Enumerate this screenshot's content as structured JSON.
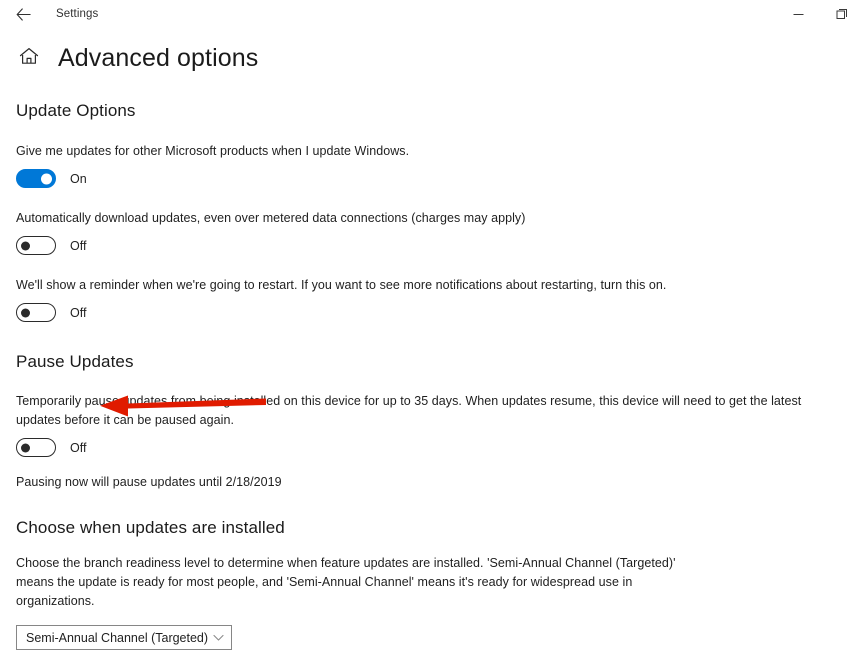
{
  "titlebar": {
    "back_icon": "back-arrow-icon",
    "app_title": "Settings",
    "minimize_label": "minimize-icon",
    "restore_label": "restore-icon"
  },
  "header": {
    "home_icon": "home-icon",
    "title": "Advanced options"
  },
  "colors": {
    "accent": "#0078d7",
    "annotation_red": "#e01b00",
    "text": "#1f1f1f",
    "border": "#868686"
  },
  "sections": [
    {
      "heading": "Update Options",
      "settings": [
        {
          "description": "Give me updates for other Microsoft products when I update Windows.",
          "state": "On"
        },
        {
          "description": "Automatically download updates, even over metered data connections (charges may apply)",
          "state": "Off"
        },
        {
          "description": "We'll show a reminder when we're going to restart. If you want to see more notifications about restarting, turn this on.",
          "state": "Off"
        }
      ]
    },
    {
      "heading": "Pause Updates",
      "settings": [
        {
          "description": "Temporarily pause updates from being installed on this device for up to 35 days. When updates resume, this device will need to get the latest updates before it can be paused again.",
          "state": "Off"
        }
      ],
      "note": "Pausing now will pause updates until 2/18/2019"
    },
    {
      "heading": "Choose when updates are installed",
      "description": "Choose the branch readiness level to determine when feature updates are installed. 'Semi-Annual Channel (Targeted)' means the update is ready for most people, and 'Semi-Annual Channel' means it's ready for widespread use in organizations.",
      "dropdown": {
        "value": "Semi-Annual Channel (Targeted)",
        "chevron": "chevron-down-icon"
      }
    }
  ],
  "annotation": {
    "type": "arrow",
    "direction": "left",
    "points_at": "pause-updates-toggle"
  }
}
